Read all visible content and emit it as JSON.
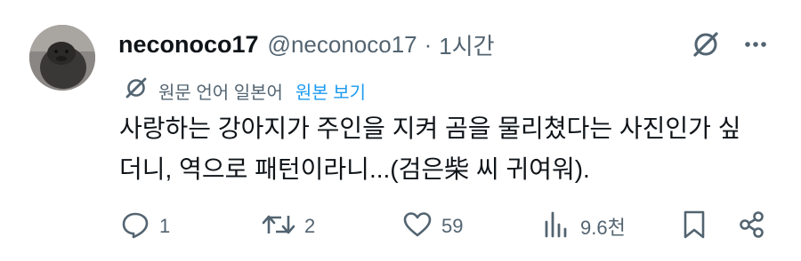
{
  "post": {
    "display_name": "neconoco17",
    "handle": "@neconoco17",
    "separator": "·",
    "time": "1시간",
    "translation": {
      "label": "원문 언어 일본어",
      "show_original": "원본 보기"
    },
    "text_lines": [
      "사랑하는 강아지가 주인을 지켜 곰을 물리쳤다는 사진인가 싶",
      "더니, 역으로 패턴이라니...(검은柴 씨 귀여워)."
    ]
  },
  "actions": {
    "reply_count": "1",
    "repost_count": "2",
    "like_count": "59",
    "views_count": "9.6천"
  },
  "icons": {
    "grok": "grok-icon",
    "more": "more-icon",
    "translate": "translate-icon",
    "reply": "reply-icon",
    "repost": "repost-icon",
    "like": "heart-icon",
    "views": "views-icon",
    "bookmark": "bookmark-icon",
    "share": "share-icon"
  },
  "colors": {
    "text": "#0f1419",
    "secondary": "#536471",
    "link": "#1d9bf0",
    "background": "#ffffff"
  }
}
